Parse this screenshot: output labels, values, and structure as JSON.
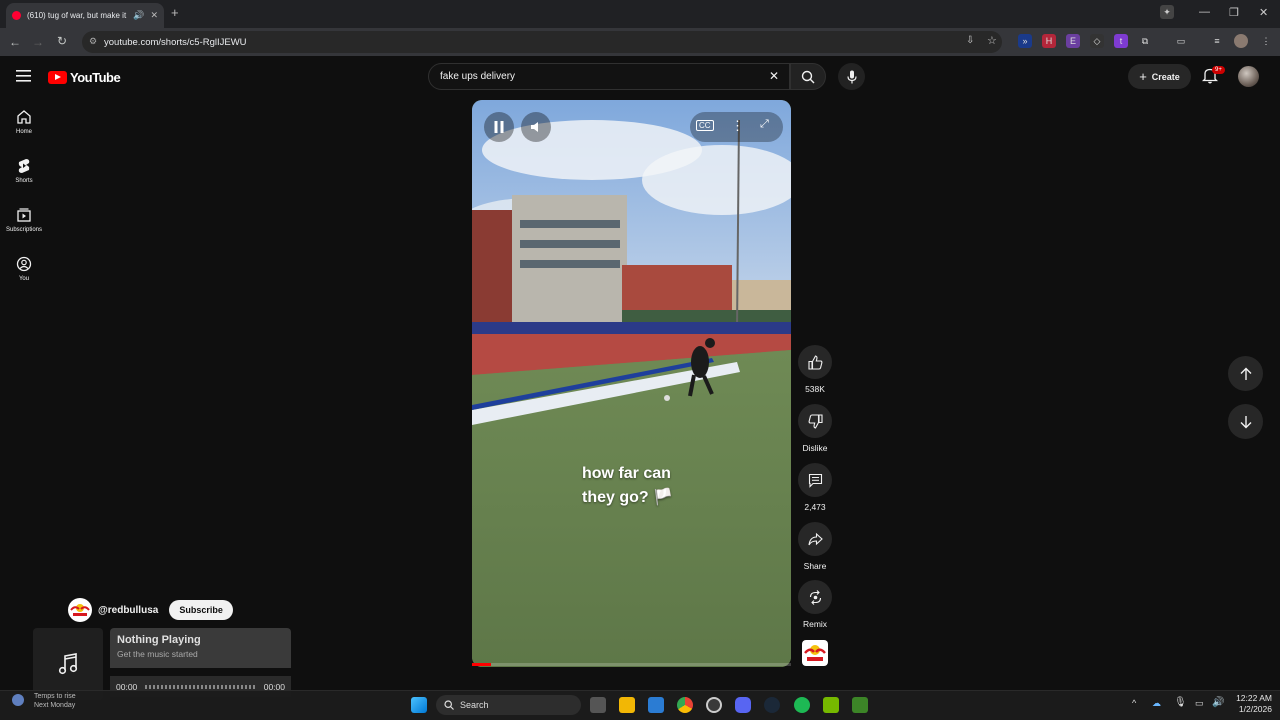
{
  "browser": {
    "tab_title": "(610) tug of war, but make it",
    "url": "youtube.com/shorts/c5-RglIJEWU"
  },
  "youtube": {
    "logo_text": "YouTube",
    "search_query": "fake ups delivery",
    "create_label": "Create",
    "notif_badge": "9+",
    "sidebar": [
      {
        "label": "Home",
        "icon": "home-icon"
      },
      {
        "label": "Shorts",
        "icon": "shorts-icon"
      },
      {
        "label": "Subscriptions",
        "icon": "subscriptions-icon"
      },
      {
        "label": "You",
        "icon": "you-icon"
      }
    ]
  },
  "short": {
    "caption_line1": "how far can",
    "caption_line2": "they go? 🏳️",
    "progress": 0.06,
    "actions": {
      "like_count": "538K",
      "dislike_label": "Dislike",
      "comment_count": "2,473",
      "share_label": "Share",
      "remix_label": "Remix"
    },
    "channel": "@redbullusa",
    "subscribe_label": "Subscribe"
  },
  "mini_player": {
    "title": "Nothing Playing",
    "subtitle": "Get the music started",
    "time_start": "00:00",
    "time_end": "00:00"
  },
  "taskbar": {
    "search_label": "Search",
    "time": "12:22 AM",
    "date": "1/2/2026",
    "weather_line1": "Temps to rise",
    "weather_line2": "Next Monday"
  },
  "colors": {
    "accent": "#ff0000",
    "background": "#0f0f0f"
  }
}
